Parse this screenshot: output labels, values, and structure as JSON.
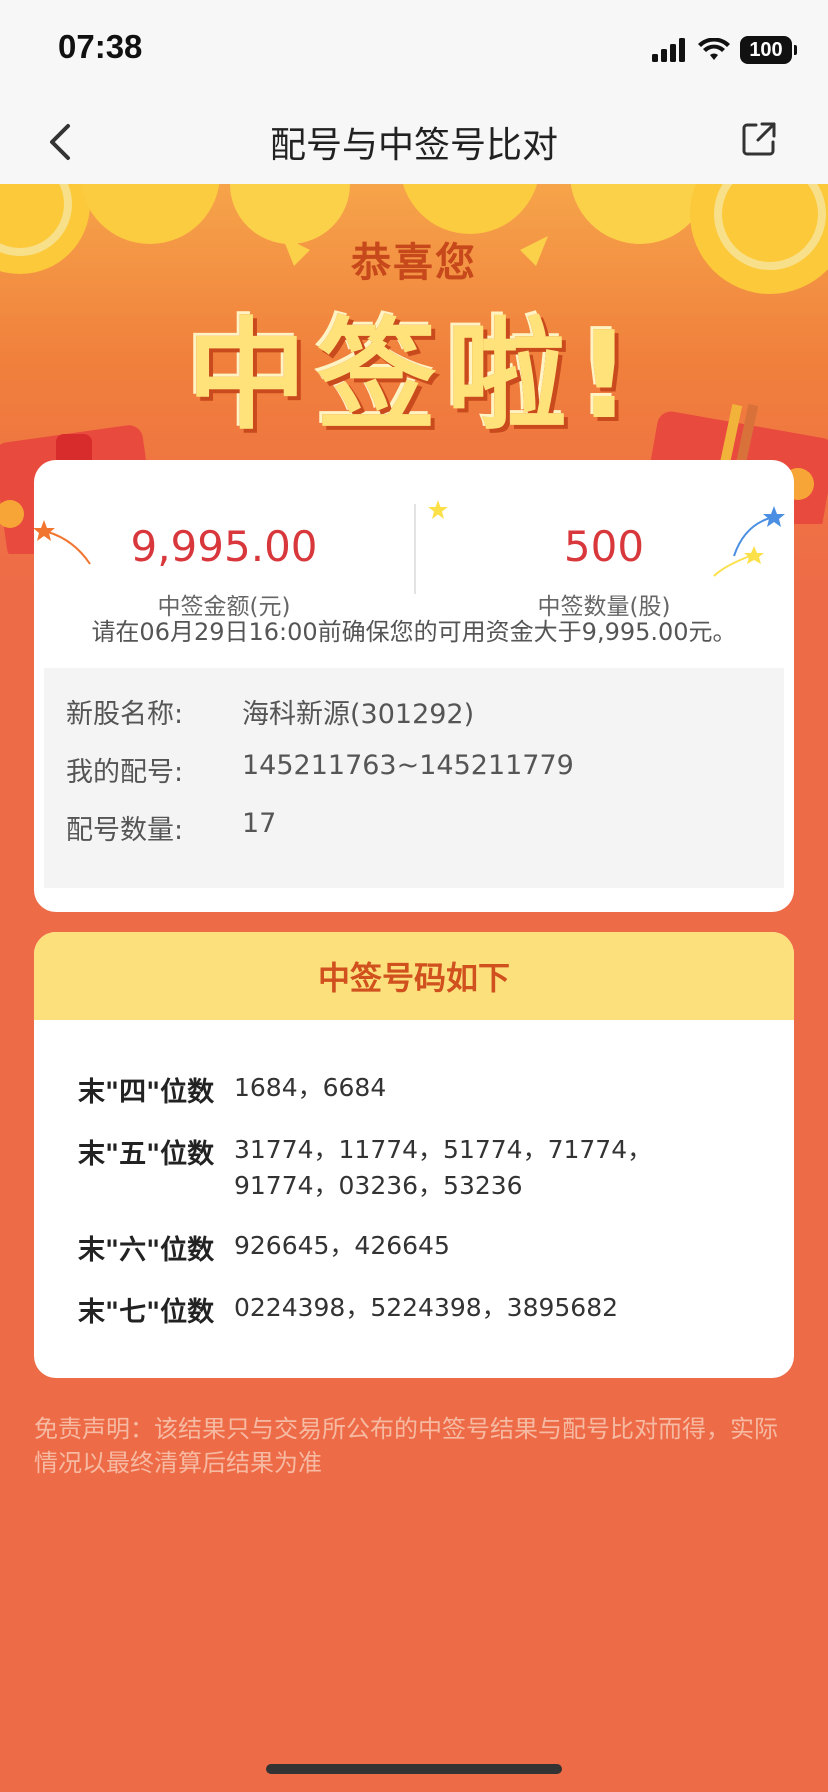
{
  "status_bar": {
    "time": "07:38",
    "battery": "100"
  },
  "nav": {
    "title": "配号与中签号比对"
  },
  "banner": {
    "subtitle": "恭喜您",
    "title": "中签啦!"
  },
  "summary": {
    "amount_value": "9,995.00",
    "amount_label": "中签金额(元)",
    "shares_value": "500",
    "shares_label": "中签数量(股)",
    "notice": "请在06月29日16:00前确保您的可用资金大于9,995.00元。"
  },
  "stock_info": {
    "name_label": "新股名称:",
    "name_value": "海科新源(301292)",
    "my_numbers_label": "我的配号:",
    "my_numbers_value": "145211763~145211779",
    "count_label": "配号数量:",
    "count_value": "17"
  },
  "lottery": {
    "header": "中签号码如下",
    "rows": [
      {
        "label": "末\"四\"位数",
        "numbers": "1684，6684"
      },
      {
        "label": "末\"五\"位数",
        "numbers": "31774，11774，51774，71774，91774，03236，53236"
      },
      {
        "label": "末\"六\"位数",
        "numbers": "926645，426645"
      },
      {
        "label": "末\"七\"位数",
        "numbers": "0224398，5224398，3895682"
      }
    ]
  },
  "disclaimer": "免责声明：该结果只与交易所公布的中签号结果与配号比对而得，实际情况以最终清算后结果为准",
  "colors": {
    "background": "#EE6B47",
    "accent_red": "#D8383C",
    "header_yellow": "#FBE07C"
  }
}
